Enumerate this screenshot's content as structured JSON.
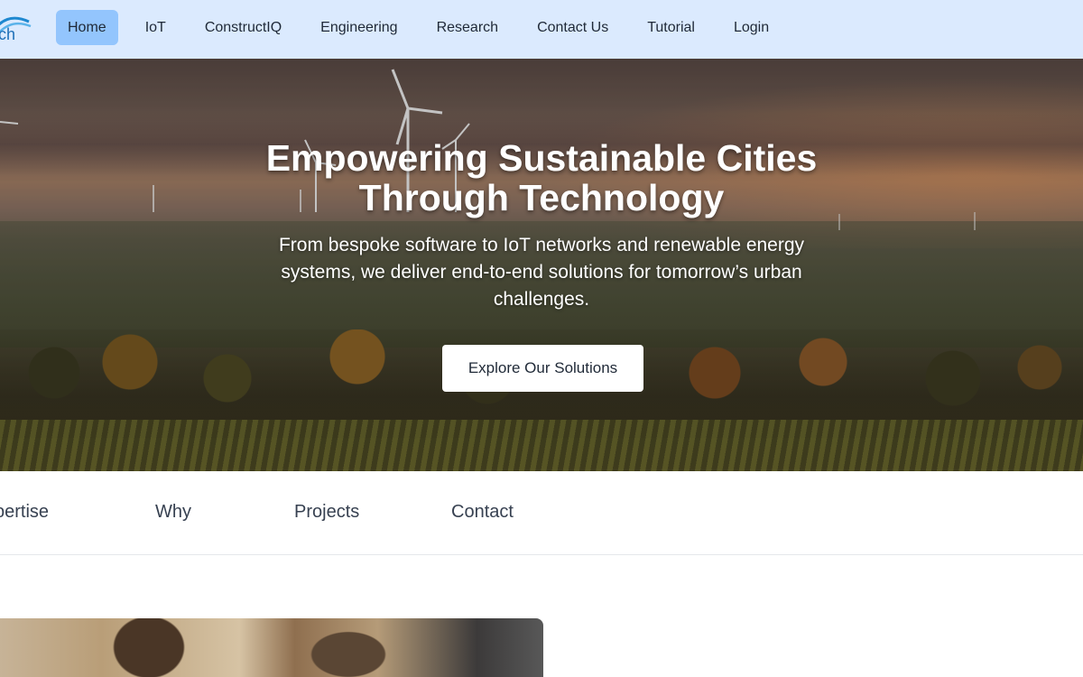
{
  "brand": {
    "logo_text": "ch",
    "logo_color": "#1e6fb8"
  },
  "nav": {
    "items": [
      {
        "label": "Home",
        "active": true
      },
      {
        "label": "IoT",
        "active": false
      },
      {
        "label": "ConstructIQ",
        "active": false
      },
      {
        "label": "Engineering",
        "active": false
      },
      {
        "label": "Research",
        "active": false
      },
      {
        "label": "Contact Us",
        "active": false
      },
      {
        "label": "Tutorial",
        "active": false
      },
      {
        "label": "Login",
        "active": false
      }
    ],
    "background": "#dbeafe",
    "active_background": "#93c5fd"
  },
  "hero": {
    "title_line1": "Empowering Sustainable Cities",
    "title_line2": "Through Technology",
    "subtitle": "From bespoke software to IoT networks and renewable energy systems, we deliver end-to-end solutions for tomorrow’s urban challenges.",
    "cta_label": "Explore Our Solutions",
    "background_image": "wind turbines over rural village landscape at sunset"
  },
  "subnav": {
    "items": [
      "pertise",
      "Why",
      "Projects",
      "Contact"
    ]
  },
  "content": {
    "card_image": "two people working together at a desk"
  }
}
